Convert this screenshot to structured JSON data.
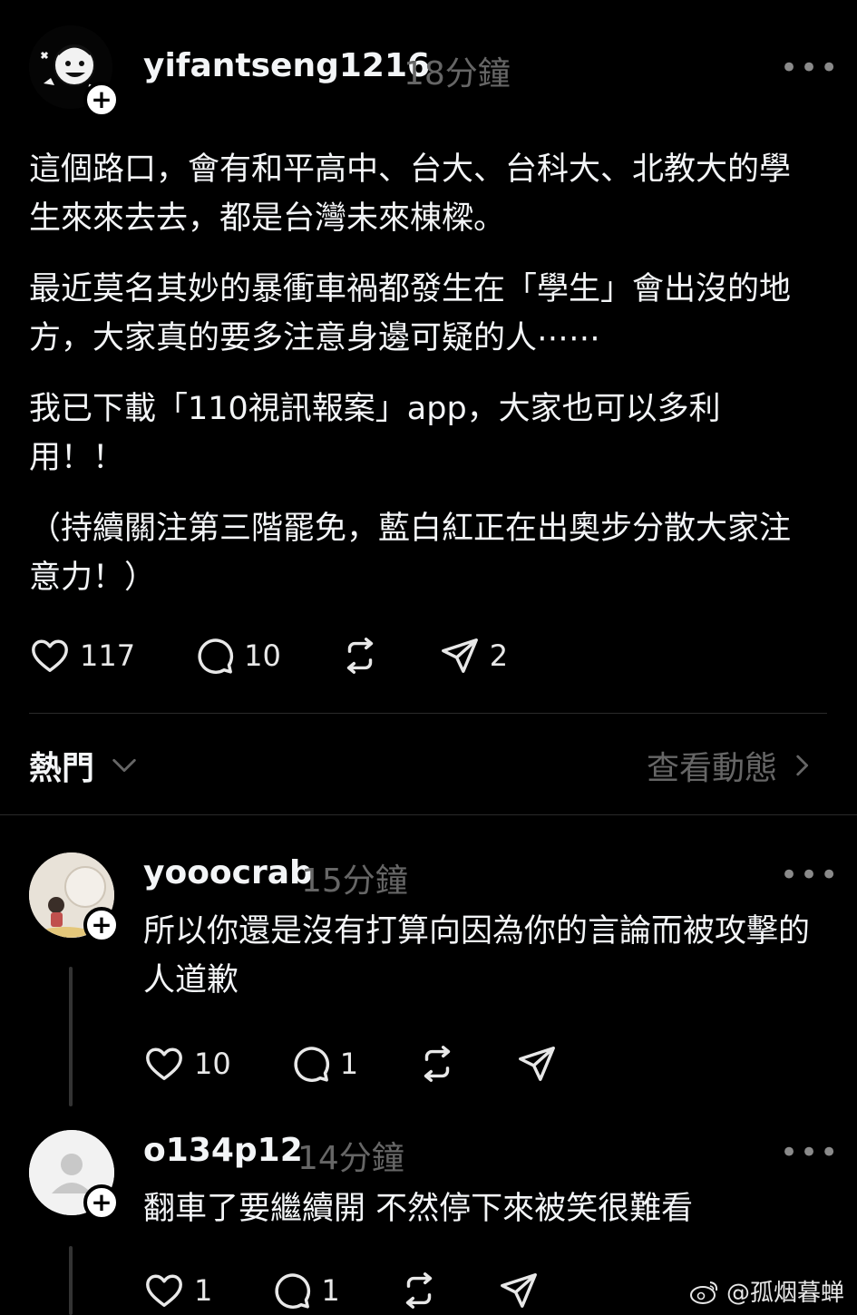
{
  "post": {
    "username": "yifantseng1216",
    "time": "18分鐘",
    "paragraphs": [
      "這個路口，會有和平高中、台大、台科大、北教大的學生來來去去，都是台灣未來棟樑。",
      "最近莫名其妙的暴衝車禍都發生在「學生」會出沒的地方，大家真的要多注意身邊可疑的人⋯⋯",
      "我已下載「110視訊報案」app，大家也可以多利用！！",
      "（持續關注第三階罷免，藍白紅正在出奧步分散大家注意力！）"
    ],
    "likes": "117",
    "comments": "10",
    "shares": "2"
  },
  "sort": {
    "label": "熱門",
    "activity_label": "查看動態"
  },
  "replies": [
    {
      "username": "yooocrab",
      "time": "15分鐘",
      "text": "所以你還是沒有打算向因為你的言論而被攻擊的人道歉",
      "likes": "10",
      "comments": "1"
    },
    {
      "username": "o134p12",
      "time": "14分鐘",
      "text": "翻車了要繼續開 不然停下來被笑很難看",
      "likes": "1",
      "comments": "1"
    }
  ],
  "watermark": "@孤烟暮蝉",
  "icons": {
    "like": "heart-icon",
    "comment": "comment-bubble-icon",
    "repost": "repost-icon",
    "share": "send-icon",
    "more": "more-dots-icon",
    "follow": "plus-icon",
    "chevron_down": "chevron-down-icon",
    "chevron_right": "chevron-right-icon",
    "watermark_logo": "weibo-logo-icon"
  }
}
